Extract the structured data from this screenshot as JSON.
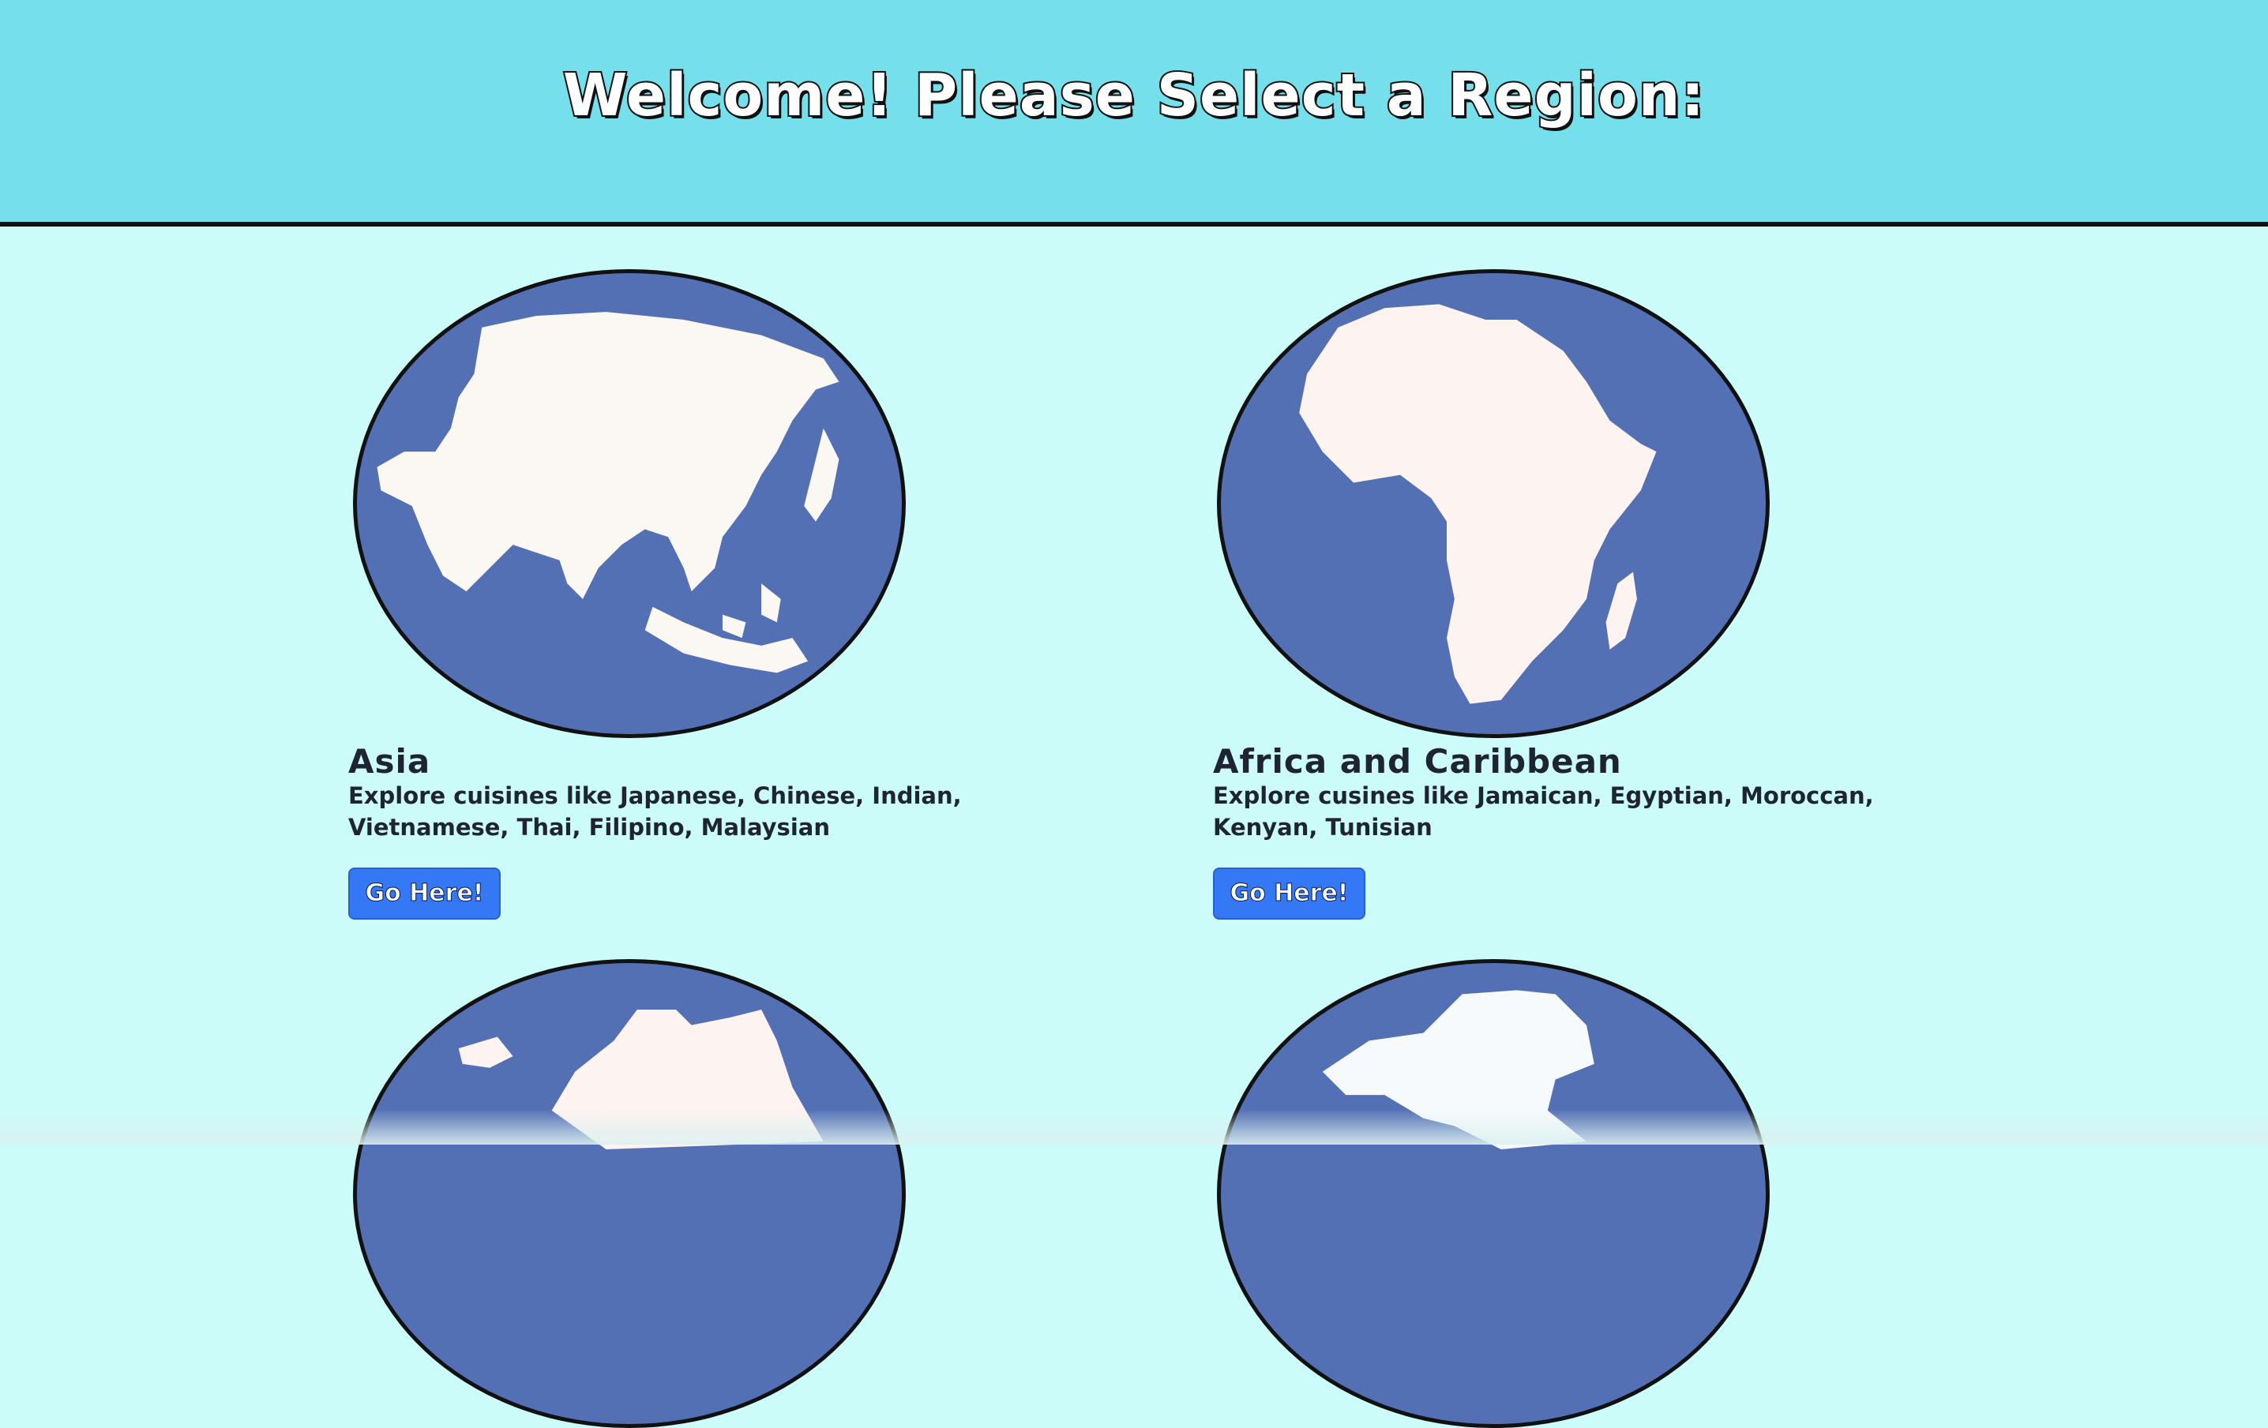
{
  "header": {
    "title": "Welcome! Please Select a Region:"
  },
  "regions": [
    {
      "name": "Asia",
      "description": "Explore cuisines like Japanese, Chinese, Indian, Vietnamese, Thai, Filipino, Malaysian",
      "button_label": "Go Here!",
      "map_icon": "asia-map-icon"
    },
    {
      "name": "Africa and Caribbean",
      "description": "Explore cusines like Jamaican, Egyptian, Moroccan, Kenyan, Tunisian",
      "button_label": "Go Here!",
      "map_icon": "africa-map-icon"
    },
    {
      "map_icon": "europe-map-icon"
    },
    {
      "map_icon": "north-america-map-icon"
    }
  ],
  "colors": {
    "header_bg": "#75e0ec",
    "page_bg": "#cbfcf9",
    "globe_ocean": "#5470b5",
    "land": "#fbf7f3",
    "button": "#3478f6"
  }
}
